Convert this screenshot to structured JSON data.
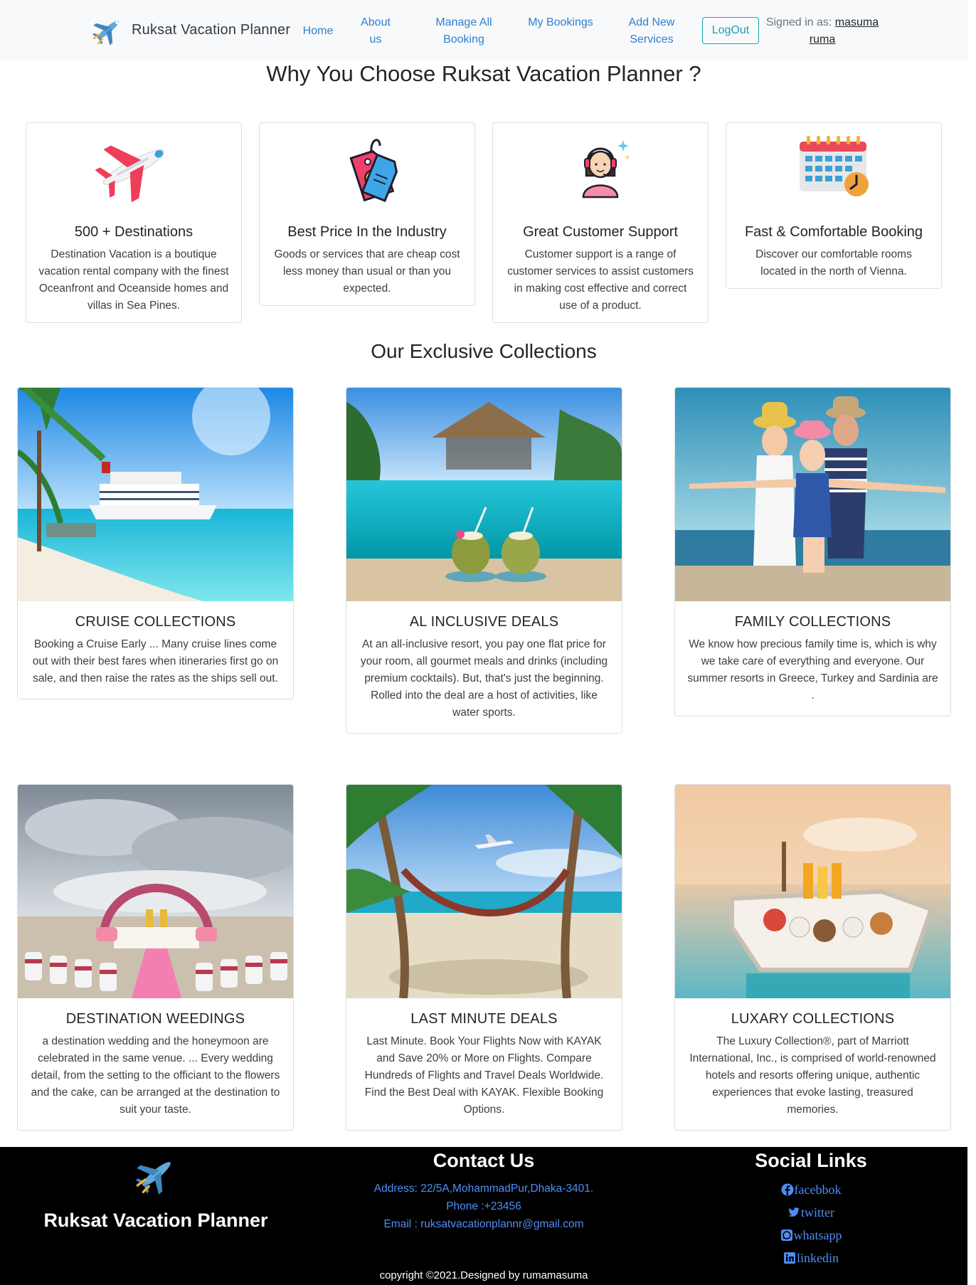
{
  "navbar": {
    "brand": "Ruksat Vacation Planner",
    "links": [
      "Home",
      "About us",
      "Manage All Booking",
      "My Bookings",
      "Add New Services"
    ],
    "logout": "LogOut",
    "signed_in_label": "Signed in as:",
    "user_name": "masuma ruma"
  },
  "why": {
    "title": "Why You Choose Ruksat Vacation Planner ?",
    "features": [
      {
        "icon": "airplane-icon",
        "title": "500 + Destinations",
        "text": "Destination Vacation is a boutique vacation rental company with the finest Oceanfront and Oceanside homes and villas in Sea Pines."
      },
      {
        "icon": "price-tag-icon",
        "title": "Best Price In the Industry",
        "text": "Goods or services that are cheap cost less money than usual or than you expected."
      },
      {
        "icon": "customer-support-icon",
        "title": "Great Customer Support",
        "text": "Customer support is a range of customer services to assist customers in making cost effective and correct use of a product."
      },
      {
        "icon": "calendar-icon",
        "title": "Fast & Comfortable Booking",
        "text": "Discover our comfortable rooms located in the north of Vienna."
      }
    ]
  },
  "collections": {
    "title": "Our Exclusive Collections",
    "items": [
      {
        "title": "CRUISE COLLECTIONS",
        "text": "Booking a Cruise Early ... Many cruise lines come out with their best fares when itineraries first go on sale, and then raise the rates as the ships sell out."
      },
      {
        "title": "AL INCLUSIVE DEALS",
        "text": "At an all-inclusive resort, you pay one flat price for your room, all gourmet meals and drinks (including premium cocktails). But, that's just the beginning. Rolled into the deal are a host of activities, like water sports."
      },
      {
        "title": "FAMILY COLLECTIONS",
        "text": "We know how precious family time is, which is why we take care of everything and everyone. Our summer resorts in Greece, Turkey and Sardinia are ."
      },
      {
        "title": "DESTINATION WEEDINGS",
        "text": "a destination wedding and the honeymoon are celebrated in the same venue. ... Every wedding detail, from the setting to the officiant to the flowers and the cake, can be arranged at the destination to suit your taste."
      },
      {
        "title": "LAST MINUTE DEALS",
        "text": "Last Minute. Book Your Flights Now with KAYAK and Save 20% or More on Flights. Compare Hundreds of Flights and Travel Deals Worldwide. Find the Best Deal with KAYAK. Flexible Booking Options."
      },
      {
        "title": "LUXARY COLLECTIONS",
        "text": "The Luxury Collection®, part of Marriott International, Inc., is comprised of world-renowned hotels and resorts offering unique, authentic experiences that evoke lasting, treasured memories."
      }
    ]
  },
  "footer": {
    "brand": "Ruksat Vacation Planner",
    "contact_title": "Contact Us",
    "address": "Address: 22/5A,MohammadPur,Dhaka-3401.",
    "phone": "Phone :+23456",
    "email": "Email : ruksatvacationplannr@gmail.com",
    "social_title": "Social Links",
    "social": [
      "facebbok",
      "twitter",
      "whatsapp",
      "linkedin"
    ],
    "copyright": "copyright ©2021.Designed by rumamasuma"
  },
  "colors": {
    "navbar_bg": "#f8f9fa",
    "link": "#2f7fd0",
    "logout": "#17a2b8",
    "footer_bg": "#000000",
    "footer_link": "#4f8df5"
  }
}
